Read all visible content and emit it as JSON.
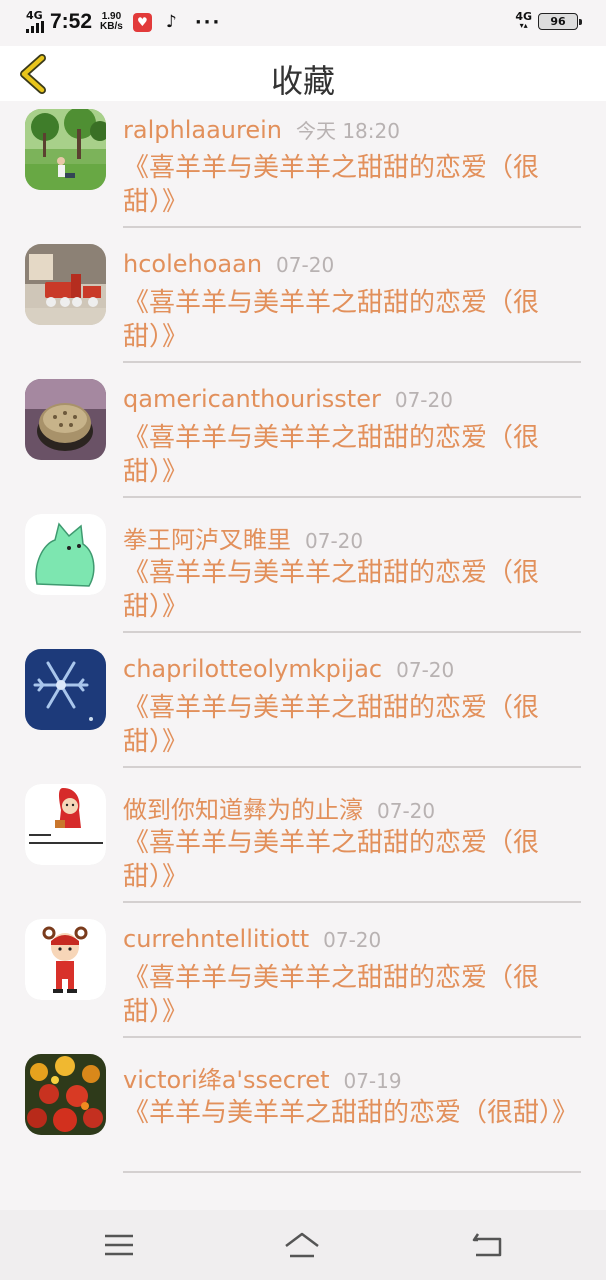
{
  "status": {
    "network_left": "4G",
    "time": "7:52",
    "speed_value": "1.90",
    "speed_unit": "KB/s",
    "network_right": "4G",
    "battery": "96"
  },
  "header": {
    "title": "收藏"
  },
  "items": [
    {
      "username": "ralphlaaurein",
      "time": "今天 18:20",
      "title": "《喜羊羊与美羊羊之甜甜的恋爱（很甜）》"
    },
    {
      "username": "hcolehoaan",
      "time": "07-20",
      "title": "《喜羊羊与美羊羊之甜甜的恋爱（很甜）》"
    },
    {
      "username": "qamericanthourisster",
      "time": "07-20",
      "title": "《喜羊羊与美羊羊之甜甜的恋爱（很甜）》"
    },
    {
      "username": "拳王阿泸叉睢里",
      "time": "07-20",
      "title": "《喜羊羊与美羊羊之甜甜的恋爱（很甜）》"
    },
    {
      "username": "chaprilotteolymkpijac",
      "time": "07-20",
      "title": "《喜羊羊与美羊羊之甜甜的恋爱（很甜）》"
    },
    {
      "username": "做到你知道彝为的止濠",
      "time": "07-20",
      "title": "《喜羊羊与美羊羊之甜甜的恋爱（很甜）》"
    },
    {
      "username": "currehntellitiott",
      "time": "07-20",
      "title": "《喜羊羊与美羊羊之甜甜的恋爱（很甜）》"
    },
    {
      "username": "victori绛a'ssecret",
      "time": "07-19",
      "title": "《羊羊与美羊羊之甜甜的恋爱（很甜）》"
    }
  ],
  "colors": {
    "accent": "#e2905b",
    "back_icon": "#e8c51c",
    "muted": "#b8b2b2"
  },
  "icons": [
    "chevron-left-icon",
    "menu-icon",
    "home-icon",
    "back-nav-icon"
  ]
}
